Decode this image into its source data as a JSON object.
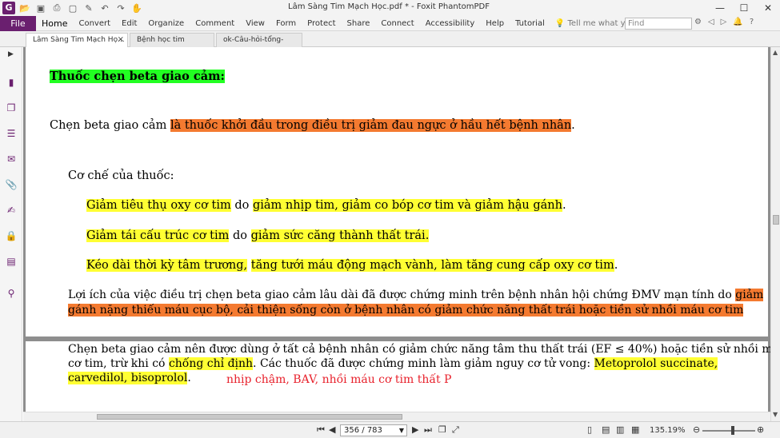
{
  "window": {
    "title": "Lâm Sàng Tim Mạch Học.pdf * - Foxit PhantomPDF",
    "logo_text": "G",
    "controls": [
      "—",
      "☐",
      "✕"
    ]
  },
  "quick_access": [
    "open-folder-icon",
    "save-icon",
    "print-icon",
    "new-icon",
    "edit-icon",
    "undo-icon",
    "redo-icon",
    "hand-tool-icon"
  ],
  "menu": {
    "file_label": "File",
    "items": [
      "Home",
      "Convert",
      "Edit",
      "Organize",
      "Comment",
      "View",
      "Form",
      "Protect",
      "Share",
      "Connect",
      "Accessibility",
      "Help",
      "Tutorial"
    ],
    "active": "Home",
    "tell_me_placeholder": "Tell me what you want to do...",
    "find_placeholder": "Find"
  },
  "tabs": [
    {
      "label": "Lâm Sàng Tim Mạch Họ...",
      "active": true,
      "close": "×"
    },
    {
      "label": "Bệnh học tim mạch.pdf",
      "active": false,
      "close": ""
    },
    {
      "label": "ok-Câu-hỏi-tổng-hợp-...",
      "active": false,
      "close": ""
    }
  ],
  "document": {
    "heading": "Thuốc chẹn beta giao cảm:",
    "p1_plain": "Chẹn beta giao cảm ",
    "p1_highlight": "là thuốc khởi đầu trong điều trị giảm đau ngực ở hầu hết bệnh nhân",
    "p1_end": ".",
    "mechanism_label": "Cơ chế của thuốc:",
    "m1_a": "Giảm tiêu thụ oxy cơ tim",
    "m1_b": " do ",
    "m1_c": "giảm nhịp tim, giảm co bóp cơ tim và giảm hậu gánh",
    "m1_d": ".",
    "m2_a": "Giảm tái cấu trúc cơ tim",
    "m2_b": " do ",
    "m2_c": "giảm sức căng thành thất trái.",
    "m3_a": "Kéo dài thời kỳ tâm trương,",
    "m3_b": " ",
    "m3_c": "tăng tưới máu động mạch vành, làm tăng cung cấp  oxy cơ tim",
    "m3_d": ".",
    "benefit_plain": "Lợi ích của việc điều trị chẹn beta giao cảm lâu dài đã được chứng minh trên bệnh nhân hội chứng ĐMV mạn tính do ",
    "benefit_hl_1": "giảm",
    "benefit_hl_2": "gánh nặng thiếu máu cục bộ, cải thiện sống còn ở bệnh nhân có giảm chức năng thất trái hoặc tiền sử nhồi máu cơ tim",
    "next_line1": "Chẹn beta giao cảm nên được dùng ở tất cả bệnh nhân có giảm chức năng tâm thu thất trái (EF ≤ 40%) hoặc tiền sử nhồi máu",
    "next_line2_a": "cơ tim, trừ khi có ",
    "next_line2_b": "chống chỉ định",
    "next_line2_c": ". Các thuốc đã được chứng minh làm giảm nguy cơ tử vong: ",
    "next_line2_d": "Metoprolol succinate,",
    "next_line3_a": "carvedilol, bisoprolol",
    "next_line3_b": ".",
    "annotation": "nhịp chậm, BAV, nhồi máu cơ tim thất P"
  },
  "status": {
    "page_display": "356 / 783",
    "zoom": "135.19%"
  },
  "colors": {
    "brand": "#6a1f6f",
    "highlight_green": "#22ff22",
    "highlight_orange": "#f47a30",
    "highlight_yellow": "#ffff33",
    "annotation_red": "#e8212c"
  }
}
